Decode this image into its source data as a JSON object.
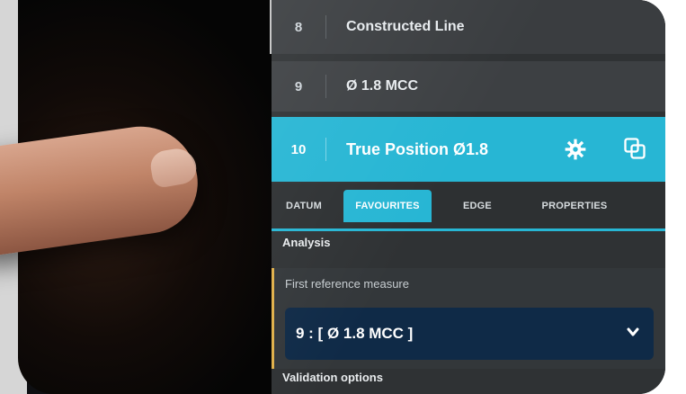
{
  "rows": [
    {
      "num": "8",
      "label": "Constructed Line"
    },
    {
      "num": "9",
      "label": "Ø 1.8 MCC"
    },
    {
      "num": "10",
      "label": "True Position Ø1.8"
    }
  ],
  "tabs": [
    {
      "label": "DATUM"
    },
    {
      "label": "FAVOURITES"
    },
    {
      "label": "EDGE"
    },
    {
      "label": "PROPERTIES"
    }
  ],
  "sections": {
    "analysis": "Analysis",
    "validation": "Validation options"
  },
  "field": {
    "label": "First reference measure",
    "value": "9 : [ Ø 1.8 MCC ]"
  },
  "icons": {
    "selected_row_actions": [
      "gear-icon",
      "copy-icon"
    ],
    "dropdown": "chevron-down-icon"
  },
  "colors": {
    "accent": "#27b6d4",
    "selected_field_marker": "#e0b04a",
    "dropdown_bg": "#0f2a47"
  }
}
